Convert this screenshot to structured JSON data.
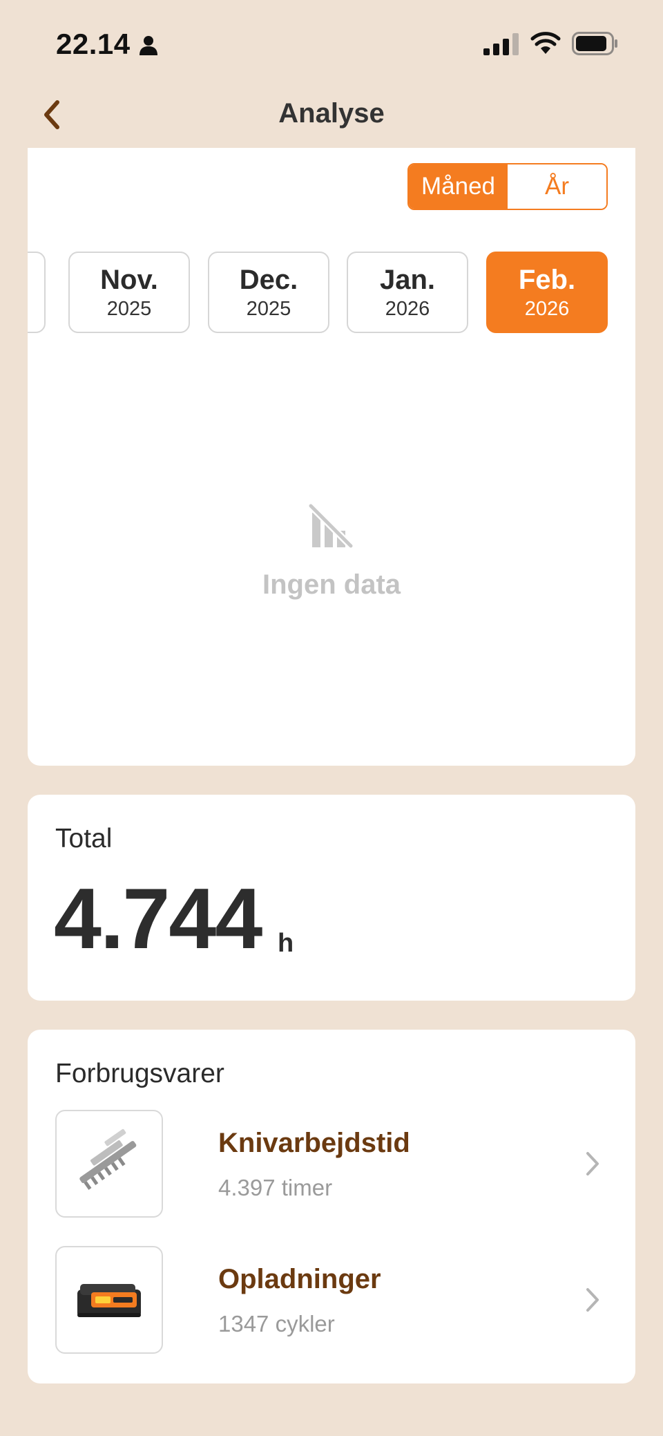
{
  "status": {
    "time": "22.14"
  },
  "nav": {
    "title": "Analyse"
  },
  "period_toggle": {
    "month": "Måned",
    "year": "År",
    "selected": "month"
  },
  "months": [
    {
      "label": "",
      "year": "",
      "partial": true
    },
    {
      "label": "Nov.",
      "year": "2025"
    },
    {
      "label": "Dec.",
      "year": "2025"
    },
    {
      "label": "Jan.",
      "year": "2026"
    },
    {
      "label": "Feb.",
      "year": "2026",
      "selected": true
    }
  ],
  "chart": {
    "empty_text": "Ingen data"
  },
  "total": {
    "label": "Total",
    "value": "4.744",
    "unit": "h"
  },
  "consumables": {
    "title": "Forbrugsvarer",
    "items": [
      {
        "name": "Knivarbejdstid",
        "detail": "4.397 timer",
        "icon": "hedge-blade-icon"
      },
      {
        "name": "Opladninger",
        "detail": "1347 cykler",
        "icon": "battery-pack-icon"
      }
    ]
  },
  "colors": {
    "accent": "#f47c20",
    "background": "#efe1d3",
    "item_title": "#6b3a10"
  }
}
